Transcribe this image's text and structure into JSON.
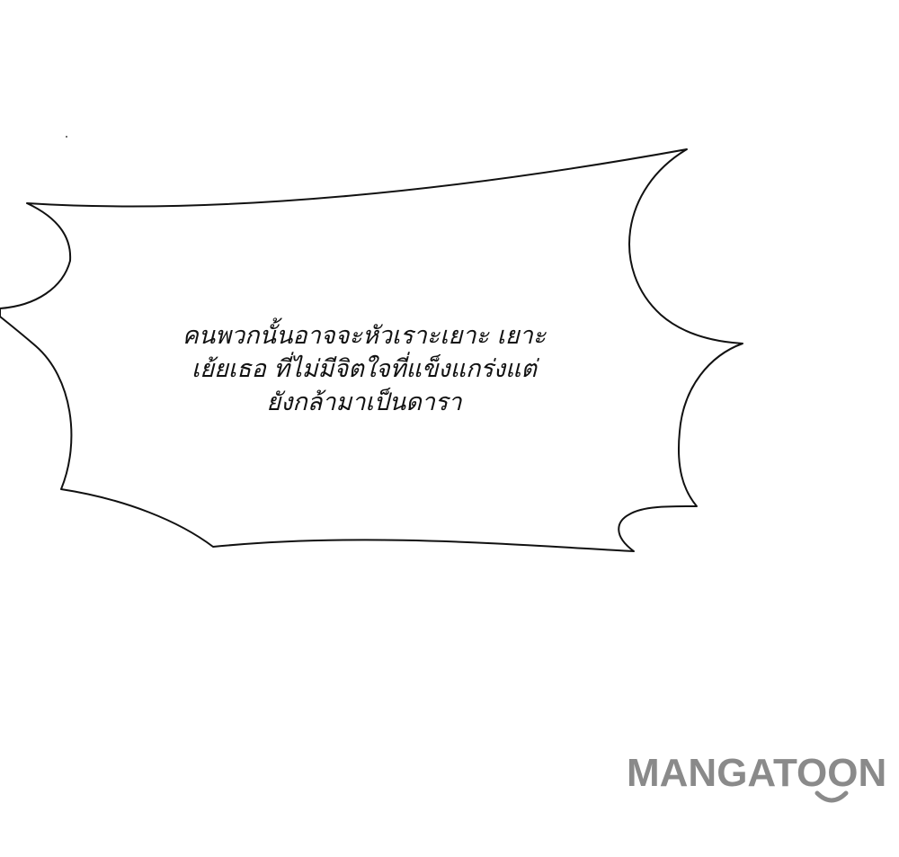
{
  "speech_bubble": {
    "lines": [
      "คนพวกนั้นอาจจะหัวเราะเยาะ เยาะ",
      "เย้ยเธอ ที่ไม่มีจิตใจที่แข็งแกร่งแต่",
      "ยังกล้ามาเป็นดารา"
    ]
  },
  "watermark": {
    "text": "MANGATOON",
    "color": "#8a8a8a"
  }
}
